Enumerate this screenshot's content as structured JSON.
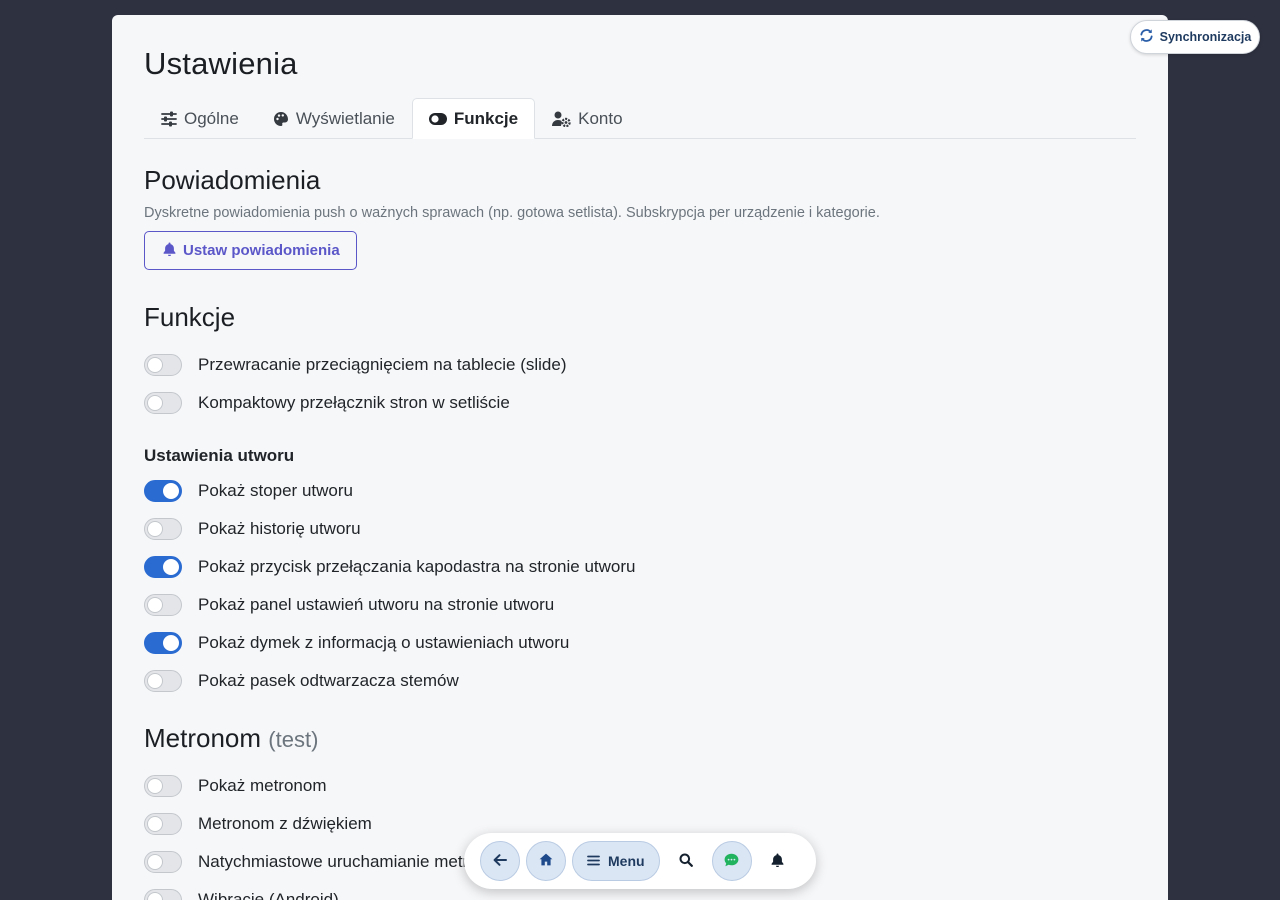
{
  "page": {
    "title": "Ustawienia"
  },
  "tabs": [
    {
      "label": "Ogólne",
      "icon": "sliders-icon",
      "active": false
    },
    {
      "label": "Wyświetlanie",
      "icon": "palette-icon",
      "active": false
    },
    {
      "label": "Funkcje",
      "icon": "toggle-icon",
      "active": true
    },
    {
      "label": "Konto",
      "icon": "user-gear-icon",
      "active": false
    }
  ],
  "notifications": {
    "heading": "Powiadomienia",
    "description": "Dyskretne powiadomienia push o ważnych sprawach (np. gotowa setlista). Subskrypcja per urządzenie i kategorie.",
    "button_label": "Ustaw powiadomienia"
  },
  "functions": {
    "heading": "Funkcje",
    "toggles": [
      {
        "label": "Przewracanie przeciągnięciem na tablecie (slide)",
        "on": false
      },
      {
        "label": "Kompaktowy przełącznik stron w setliście",
        "on": false
      }
    ]
  },
  "song_settings": {
    "heading": "Ustawienia utworu",
    "toggles": [
      {
        "label": "Pokaż stoper utworu",
        "on": true
      },
      {
        "label": "Pokaż historię utworu",
        "on": false
      },
      {
        "label": "Pokaż przycisk przełączania kapodastra na stronie utworu",
        "on": true
      },
      {
        "label": "Pokaż panel ustawień utworu na stronie utworu",
        "on": false
      },
      {
        "label": "Pokaż dymek z informacją o ustawieniach utworu",
        "on": true
      },
      {
        "label": "Pokaż pasek odtwarzacza stemów",
        "on": false
      }
    ]
  },
  "metronome": {
    "heading": "Metronom",
    "suffix": "(test)",
    "toggles": [
      {
        "label": "Pokaż metronom",
        "on": false
      },
      {
        "label": "Metronom z dźwiękiem",
        "on": false
      },
      {
        "label": "Natychmiastowe uruchamianie metronomu",
        "on": false
      },
      {
        "label": "Wibracje (Android)",
        "on": false
      }
    ]
  },
  "sync": {
    "label": "Synchronizacja"
  },
  "dock": {
    "menu_label": "Menu"
  },
  "colors": {
    "background": "#2e3140",
    "card": "#f6f7f9",
    "toggle_on": "#2a6bd1",
    "accent": "#5b57c9",
    "chat_green": "#22b35e"
  }
}
